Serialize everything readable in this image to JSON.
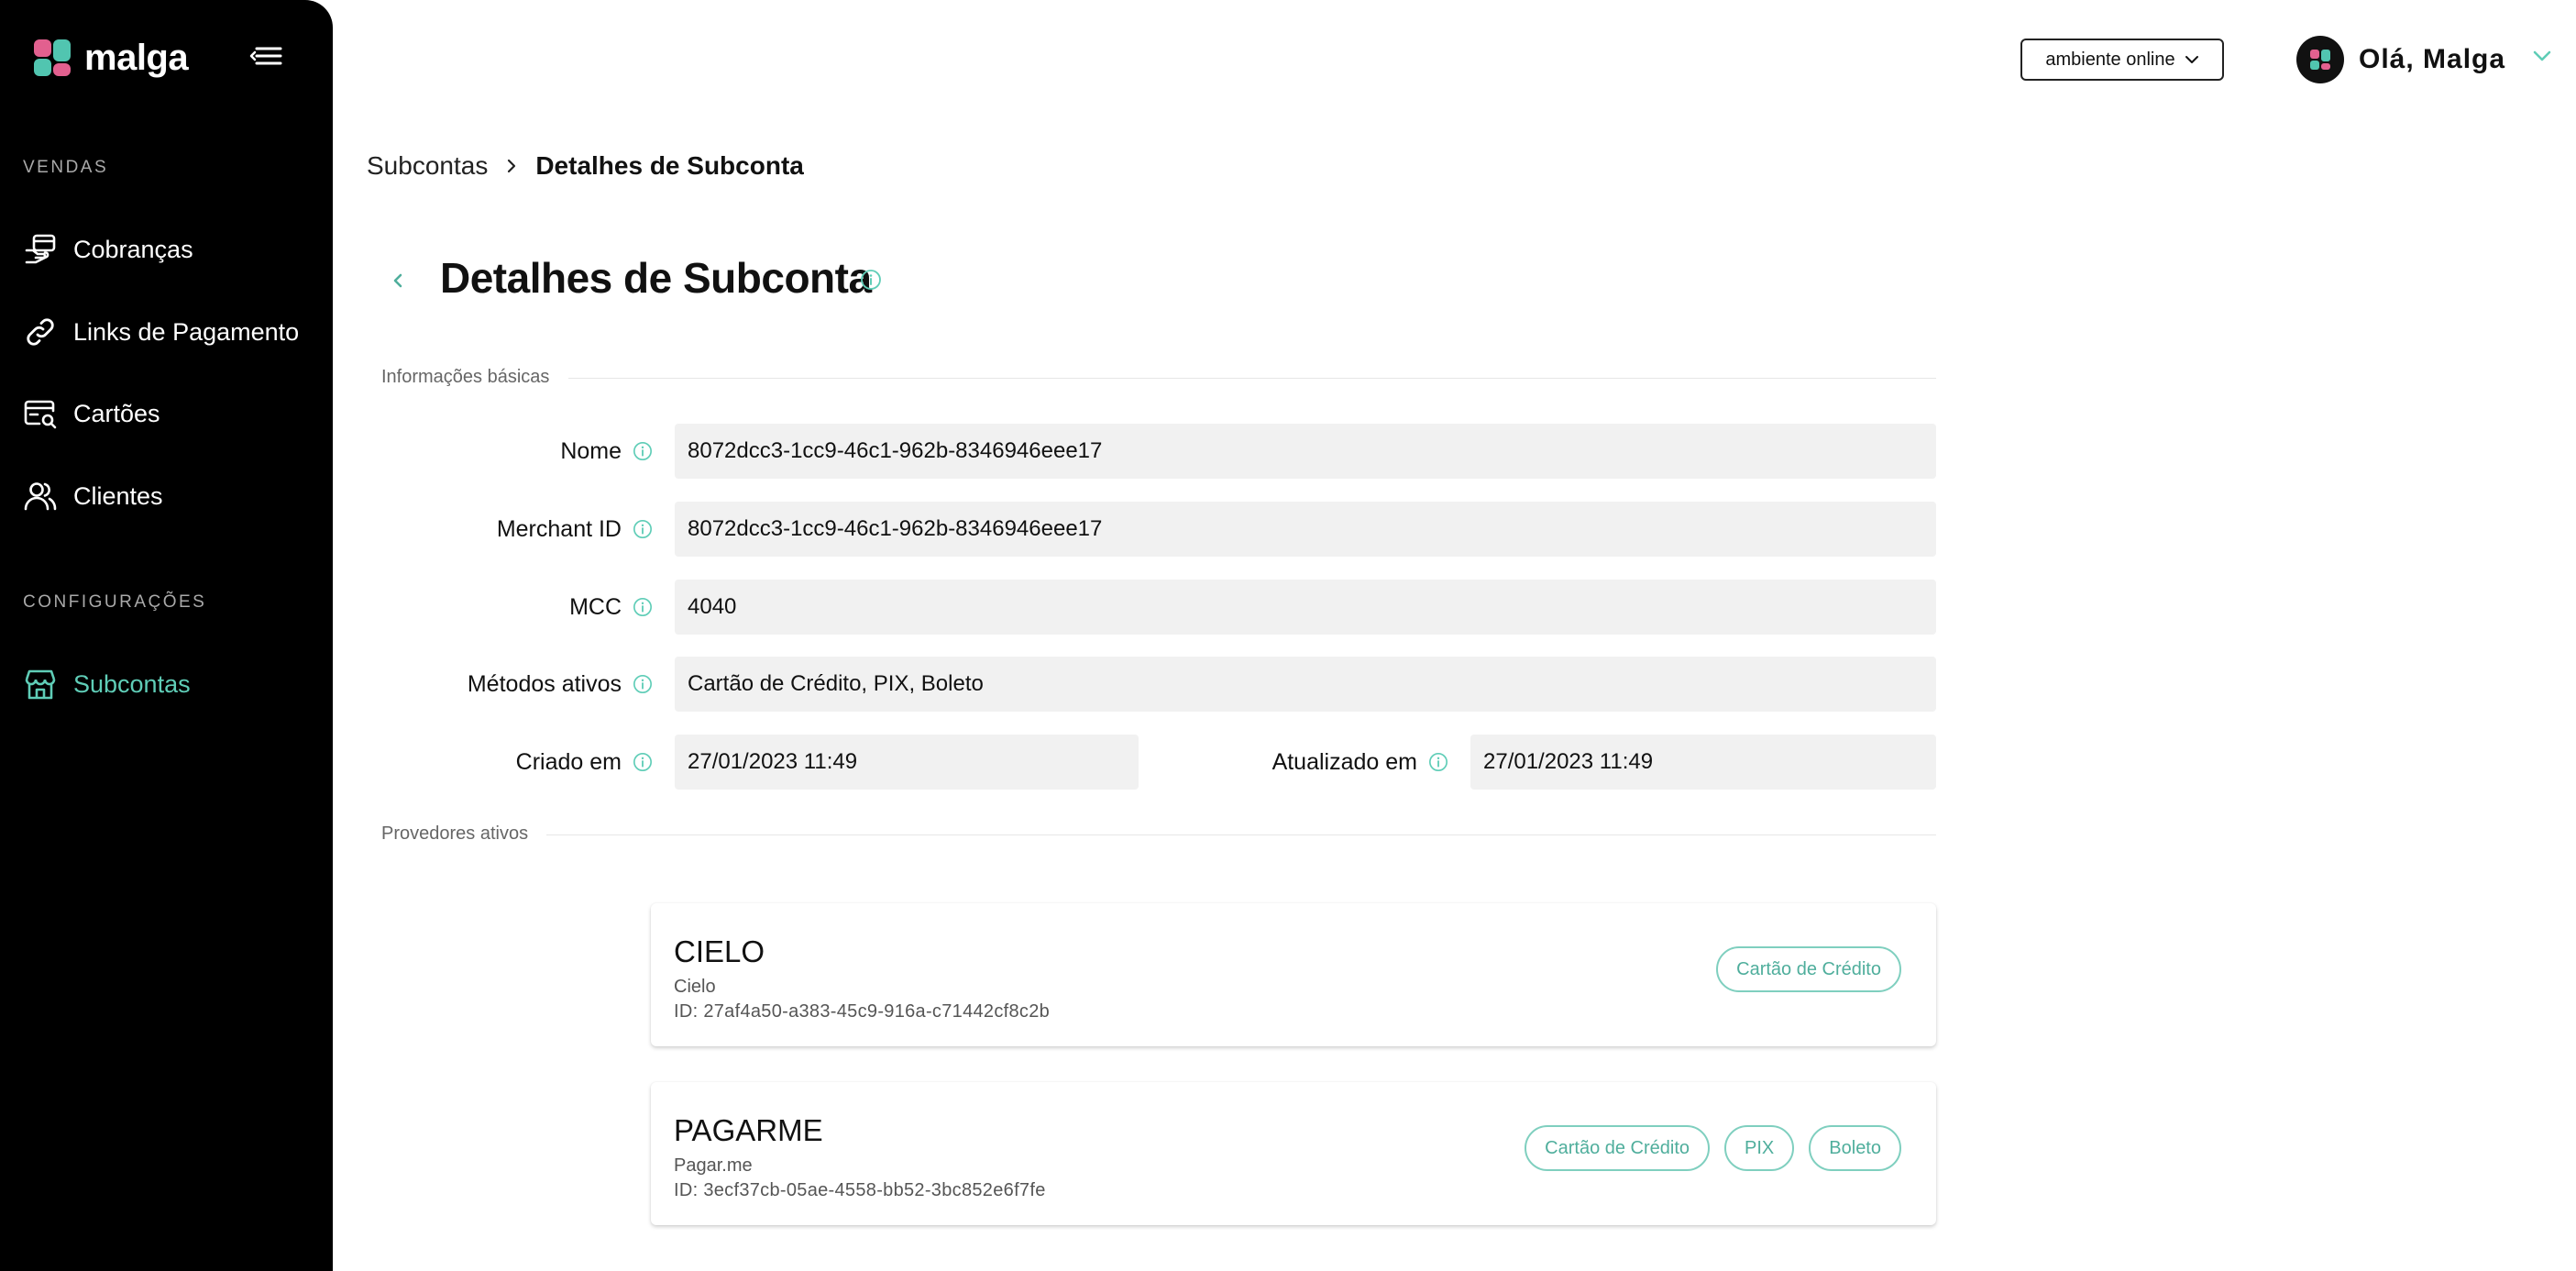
{
  "brand": {
    "name": "malga"
  },
  "sidebar": {
    "sections": [
      {
        "label": "VENDAS"
      },
      {
        "label": "CONFIGURAÇÕES"
      }
    ],
    "items": [
      {
        "label": "Cobranças",
        "icon": "charges-icon"
      },
      {
        "label": "Links de Pagamento",
        "icon": "link-icon"
      },
      {
        "label": "Cartões",
        "icon": "card-search-icon"
      },
      {
        "label": "Clientes",
        "icon": "users-icon"
      },
      {
        "label": "Subcontas",
        "icon": "store-icon",
        "active": true
      }
    ]
  },
  "topbar": {
    "environment": "ambiente online",
    "greeting": "Olá, Malga"
  },
  "breadcrumb": {
    "parent": "Subcontas",
    "current": "Detalhes de Subconta"
  },
  "page": {
    "title": "Detalhes de Subconta"
  },
  "basic_info": {
    "section_label": "Informações básicas",
    "fields": {
      "name": {
        "label": "Nome",
        "value": "8072dcc3-1cc9-46c1-962b-8346946eee17"
      },
      "merchant_id": {
        "label": "Merchant ID",
        "value": "8072dcc3-1cc9-46c1-962b-8346946eee17"
      },
      "mcc": {
        "label": "MCC",
        "value": "4040"
      },
      "methods": {
        "label": "Métodos ativos",
        "value": "Cartão de Crédito, PIX, Boleto"
      },
      "created": {
        "label": "Criado em",
        "value": "27/01/2023 11:49"
      },
      "updated": {
        "label": "Atualizado em",
        "value": "27/01/2023 11:49"
      }
    }
  },
  "providers": {
    "section_label": "Provedores ativos",
    "items": [
      {
        "name": "CIELO",
        "display": "Cielo",
        "id": "ID: 27af4a50-a383-45c9-916a-c71442cf8c2b",
        "methods": [
          "Cartão de Crédito"
        ]
      },
      {
        "name": "PAGARME",
        "display": "Pagar.me",
        "id": "ID: 3ecf37cb-05ae-4558-bb52-3bc852e6f7fe",
        "methods": [
          "Cartão de Crédito",
          "PIX",
          "Boleto"
        ]
      }
    ]
  },
  "colors": {
    "accent": "#5fcdb7",
    "brand_pink": "#e2608f",
    "brand_teal": "#51c5b0",
    "sidebar_bg": "#000000"
  }
}
